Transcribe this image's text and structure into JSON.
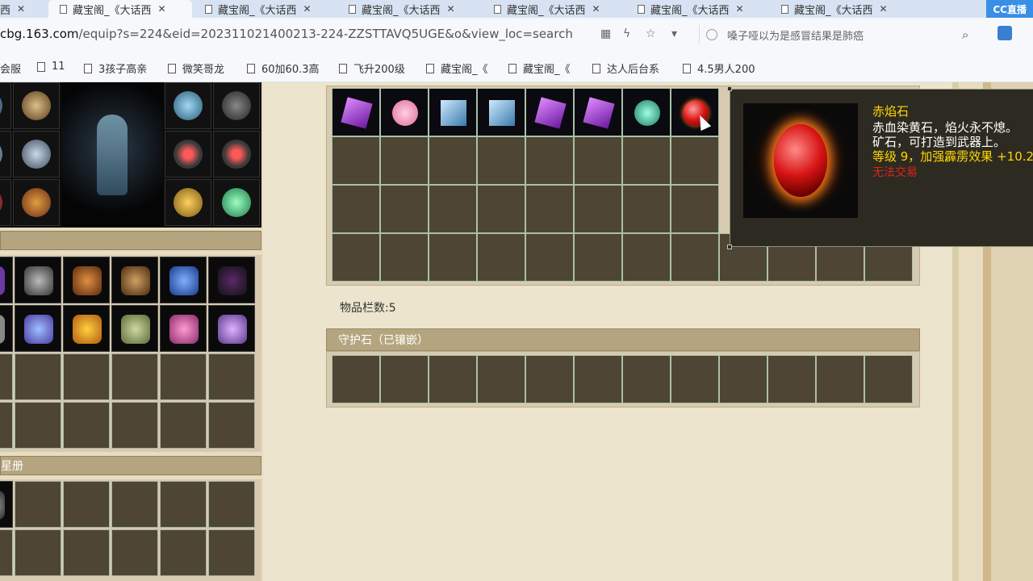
{
  "tabs": [
    {
      "label": "西",
      "active": false
    },
    {
      "label": "藏宝阁_《大话西",
      "active": true
    },
    {
      "label": "藏宝阁_《大话西",
      "active": false
    },
    {
      "label": "藏宝阁_《大话西",
      "active": false
    },
    {
      "label": "藏宝阁_《大话西",
      "active": false
    },
    {
      "label": "藏宝阁_《大话西",
      "active": false
    },
    {
      "label": "藏宝阁_《大话西",
      "active": false
    }
  ],
  "brand": {
    "label": "CC直播"
  },
  "address": {
    "host": "cbg.163.com",
    "path": "/equip?s=224&eid=202311021400213-224-ZZSTTAVQ5UGE&o&view_loc=search"
  },
  "search_suggestion": "嗓子哑以为是感冒结果是肺癌",
  "bookmarks": [
    "会服",
    "11",
    "3孩子高亲",
    "微笑哥龙",
    "60加60.3高",
    "飞升200级",
    "藏宝阁_《",
    "藏宝阁_《",
    "达人后台系",
    "4.5男人200"
  ],
  "left_sections": {
    "star_book": "星册"
  },
  "inventory": {
    "count_label": "物品栏数:5"
  },
  "guard_stone": {
    "header": "守护石（已镶嵌）"
  },
  "tooltip": {
    "name": "赤焰石",
    "desc_line1": "赤血染黄石，焰火永不熄。",
    "desc_line2": "矿石，可打造到武器上。",
    "stat": "等级 9，加强霹雳效果 +10.2",
    "trade": "无法交易"
  },
  "colors": {
    "accent_gold": "#ffd700",
    "warn_red": "#e02020",
    "section_header": "#b5a57f"
  }
}
